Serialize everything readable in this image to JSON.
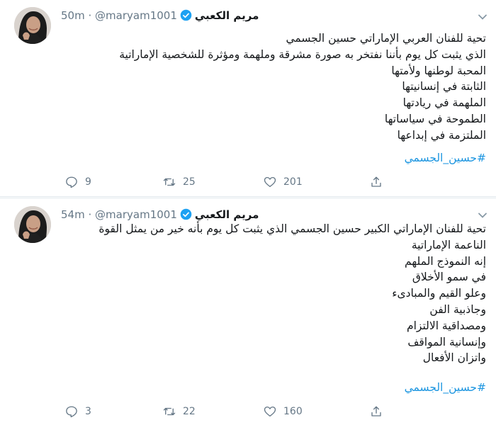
{
  "tweets": [
    {
      "author_name": "مريم الكعبي",
      "handle": "@maryam1001",
      "separator": "·",
      "time": "50m",
      "lines": [
        "تحية للفنان العربي الإماراتي حسين الجسمي",
        "الذي يثبت كل يوم بأننا نفتخر به صورة مشرقة وملهمة ومؤثرة للشخصية الإماراتية",
        "المحبة لوطنها ولأمتها",
        "الثابتة في إنسانيتها",
        "الملهمة في ريادتها",
        "الطموحة في سياساتها",
        "الملتزمة في إبداعها"
      ],
      "hashtag": "#حسين_الجسمي",
      "replies": "9",
      "retweets": "25",
      "likes": "201",
      "verified_color": "#1da1f2",
      "icons": {
        "verified": "verified-badge-icon",
        "menu": "chevron-down-icon",
        "reply": "reply-icon",
        "retweet": "retweet-icon",
        "like": "heart-icon",
        "share": "share-icon"
      }
    },
    {
      "author_name": "مريم الكعبي",
      "handle": "@maryam1001",
      "separator": "·",
      "time": "54m",
      "lines": [
        "تحية للفنان الإماراتي الكبير حسين الجسمي الذي يثبت كل يوم بأنه خير من يمثل القوة",
        "الناعمة الإماراتية",
        "إنه النموذج الملهم",
        "في سمو الأخلاق",
        "وعلو القيم والمبادىء",
        "وجاذبية الفن",
        "ومصداقية الالتزام",
        "وإنسانية المواقف",
        "واتزان الأفعال"
      ],
      "hashtag": "#حسين_الجسمي",
      "replies": "3",
      "retweets": "22",
      "likes": "160",
      "verified_color": "#1da1f2",
      "icons": {
        "verified": "verified-badge-icon",
        "menu": "chevron-down-icon",
        "reply": "reply-icon",
        "retweet": "retweet-icon",
        "like": "heart-icon",
        "share": "share-icon"
      }
    }
  ],
  "colors": {
    "hashtag": "#1b95e0",
    "secondary_text": "#657786",
    "divider": "#e1e8ed"
  }
}
